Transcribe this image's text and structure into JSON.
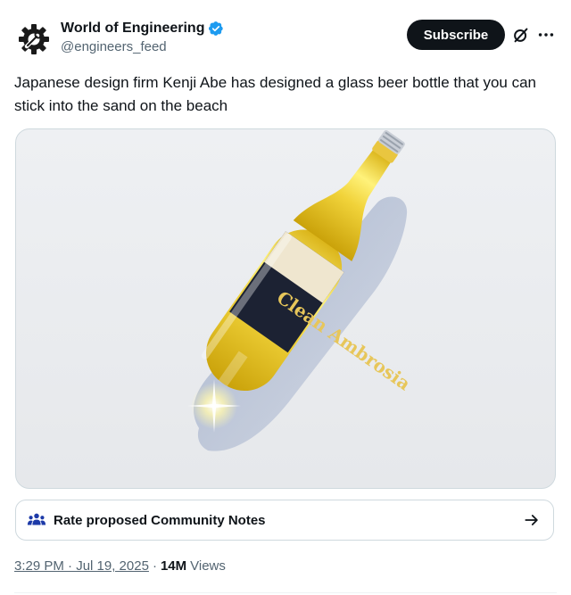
{
  "author": {
    "name": "World of Engineering",
    "handle": "@engineers_feed",
    "avatar_icon": "gear-wrench-logo",
    "verified_icon": "verified-badge-icon",
    "verified_color": "#1d9bf0"
  },
  "actions": {
    "subscribe_label": "Subscribe",
    "grok_icon": "grok-icon",
    "more_icon": "more-icon"
  },
  "tweet": {
    "text": "Japanese design firm Kenji Abe has designed a glass beer bottle that you can stick into the sand on the beach"
  },
  "media": {
    "bottle_label": "Clean Ambrosia"
  },
  "community_notes": {
    "label": "Rate proposed Community Notes",
    "icon": "people-icon",
    "arrow_icon": "arrow-right-icon",
    "icon_color": "#1d3aa8"
  },
  "meta": {
    "time": "3:29 PM · Jul 19, 2025",
    "separator": "·",
    "views_count": "14M",
    "views_label": "Views"
  }
}
